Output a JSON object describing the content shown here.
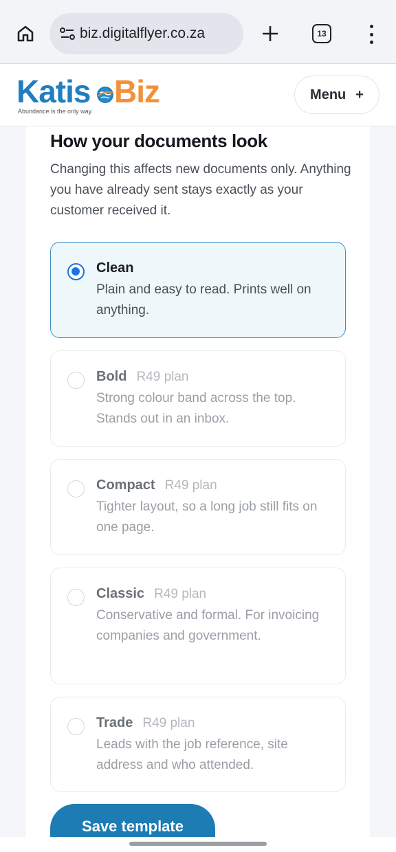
{
  "browser": {
    "url": "biz.digitalflyer.co.za",
    "tab_count": "13"
  },
  "header": {
    "logo_primary": "Katis",
    "logo_secondary": "Biz",
    "logo_tagline": "Abundance is the only way.",
    "menu_label": "Menu",
    "menu_icon": "+"
  },
  "section": {
    "title": "How your documents look",
    "description": "Changing this affects new documents only. Anything you have already sent stays exactly as your customer received it."
  },
  "templates": [
    {
      "name": "Clean",
      "plan": "",
      "description": "Plain and easy to read. Prints well on anything.",
      "selected": true
    },
    {
      "name": "Bold",
      "plan": "R49 plan",
      "description": "Strong colour band across the top. Stands out in an inbox.",
      "selected": false
    },
    {
      "name": "Compact",
      "plan": "R49 plan",
      "description": "Tighter layout, so a long job still fits on one page.",
      "selected": false
    },
    {
      "name": "Classic",
      "plan": "R49 plan",
      "description": "Conservative and formal. For invoicing companies and government.",
      "selected": false
    },
    {
      "name": "Trade",
      "plan": "R49 plan",
      "description": "Leads with the job reference, site address and who attended.",
      "selected": false
    }
  ],
  "save_button": "Save template",
  "colors": {
    "accent": "#1a73e8",
    "brand_blue": "#1f7fc0",
    "brand_orange": "#f2913b",
    "button": "#1d7cb4"
  }
}
